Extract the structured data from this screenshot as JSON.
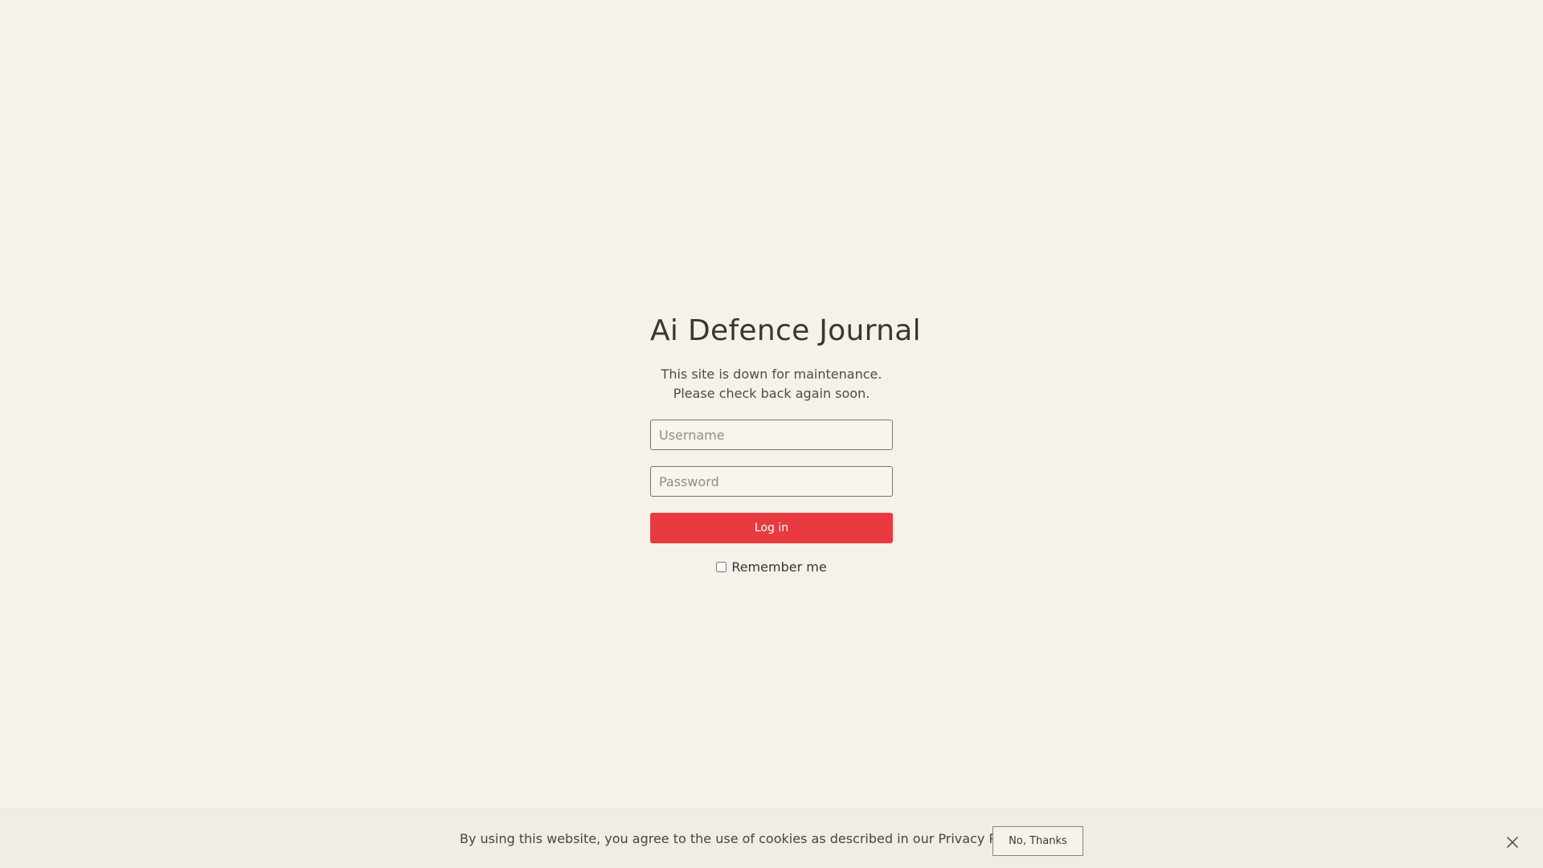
{
  "site": {
    "title": "Ai Defence Journal",
    "message_line1": "This site is down for maintenance.",
    "message_line2": "Please check back again soon."
  },
  "login": {
    "username_placeholder": "Username",
    "password_placeholder": "Password",
    "button_label": "Log in",
    "remember_label": "Remember me",
    "remember_checked": false
  },
  "cookie_bar": {
    "text": "By using this website, you agree to the use of cookies as described in our Privacy Policy.",
    "dismiss_label": "No, Thanks",
    "close_icon": "close-icon"
  },
  "colors": {
    "background": "#f6f2e9",
    "accent": "#e83a40"
  }
}
